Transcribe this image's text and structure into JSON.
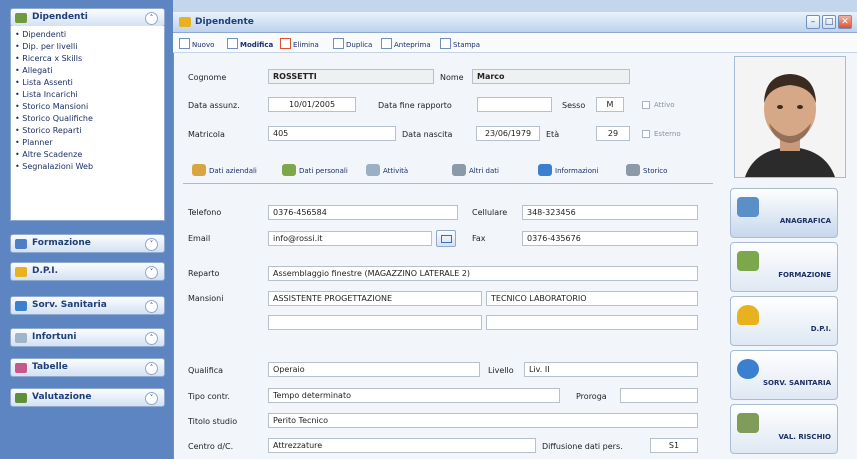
{
  "sidebar": {
    "dipendenti_title": "Dipendenti",
    "dipendenti_items": [
      "Dipendenti",
      "Dip. per livelli",
      "Ricerca x Skills",
      "Allegati",
      "Lista Assenti",
      "Lista Incarichi",
      "Storico Mansioni",
      "Storico Qualifiche",
      "Storico Reparti",
      "Planner",
      "Altre Scadenze",
      "Segnalazioni Web"
    ],
    "sections": [
      "Formazione",
      "D.P.I.",
      "Sorv. Sanitaria",
      "Infortuni",
      "Tabelle",
      "Valutazione"
    ]
  },
  "window": {
    "title": "Dipendente"
  },
  "toolbar": [
    "Nuovo",
    "Modifica",
    "Elimina",
    "Duplica",
    "Anteprima",
    "Stampa"
  ],
  "form": {
    "cognome_label": "Cognome",
    "cognome": "ROSSETTI",
    "nome_label": "Nome",
    "nome": "Marco",
    "data_assunz_label": "Data assunz.",
    "data_assunz": "10/01/2005",
    "data_fine_label": "Data fine rapporto",
    "data_fine": "",
    "sesso_label": "Sesso",
    "sesso": "M",
    "attivo_label": "Attivo",
    "matricola_label": "Matricola",
    "matricola": "405",
    "data_nascita_label": "Data nascita",
    "data_nascita": "23/06/1979",
    "eta_label": "Età",
    "eta": "29",
    "esterno_label": "Esterno"
  },
  "tabs": [
    "Dati aziendali",
    "Dati personali",
    "Attività",
    "Altri dati",
    "Informazioni",
    "Storico"
  ],
  "details": {
    "telefono_label": "Telefono",
    "telefono": "0376-456584",
    "cellulare_label": "Cellulare",
    "cellulare": "348-323456",
    "email_label": "Email",
    "email": "info@rossi.it",
    "fax_label": "Fax",
    "fax": "0376-435676",
    "reparto_label": "Reparto",
    "reparto": "Assemblaggio finestre (MAGAZZINO LATERALE 2)",
    "mansioni_label": "Mansioni",
    "mansione1": "ASSISTENTE PROGETTAZIONE",
    "mansione2": "TECNICO LABORATORIO",
    "qualifica_label": "Qualifica",
    "qualifica": "Operaio",
    "livello_label": "Livello",
    "livello": "Liv. II",
    "tipo_contr_label": "Tipo contr.",
    "tipo_contr": "Tempo determinato",
    "proroga_label": "Proroga",
    "proroga": "",
    "titolo_label": "Titolo studio",
    "titolo": "Perito Tecnico",
    "centro_label": "Centro d/C.",
    "centro": "Attrezzature",
    "diffusione_label": "Diffusione dati pers.",
    "diffusione": "S1"
  },
  "right_buttons": [
    "ANAGRAFICA",
    "FORMAZIONE",
    "D.P.I.",
    "SORV. SANITARIA",
    "VAL. RISCHIO"
  ]
}
